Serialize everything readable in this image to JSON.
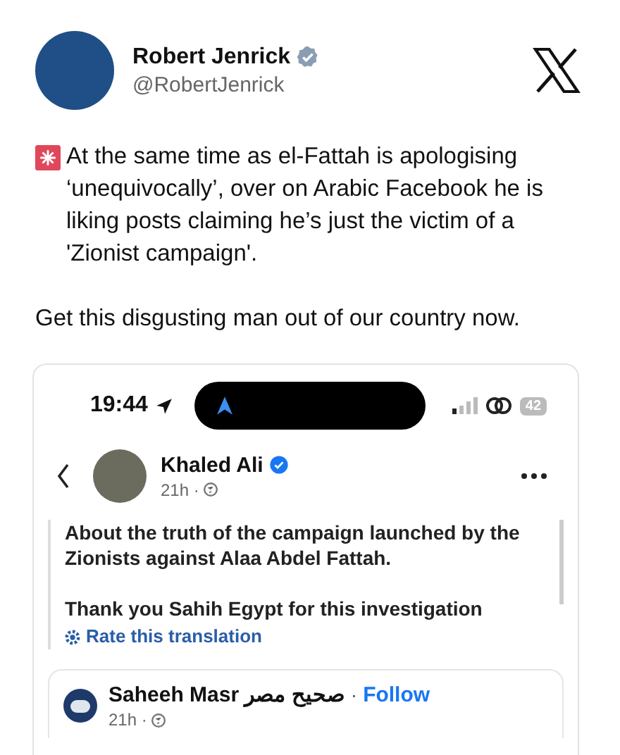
{
  "tweet": {
    "author_name": "Robert Jenrick",
    "verified": true,
    "handle": "@RobertJenrick",
    "paragraphs": [
      "At the same time as el-Fattah is apologising ‘unequivocally’, over on Arabic Facebook he is liking posts claiming he’s just the victim of a 'Zionist campaign'.",
      "Get this disgusting man out of our country now."
    ]
  },
  "screenshot": {
    "status_bar": {
      "time": "19:44",
      "battery": "42"
    },
    "post": {
      "author_name": "Khaled Ali",
      "verified": true,
      "time": "21h ·",
      "paragraphs": [
        "About the truth of the campaign launched by the Zionists against Alaa Abdel Fattah.",
        "Thank you Sahih Egypt for this investigation"
      ],
      "translation_link": "Rate this translation"
    },
    "shared_post": {
      "author_name": "Saheeh Masr صحيح مصر",
      "separator": "·",
      "follow": "Follow",
      "time": "21h ·"
    }
  }
}
